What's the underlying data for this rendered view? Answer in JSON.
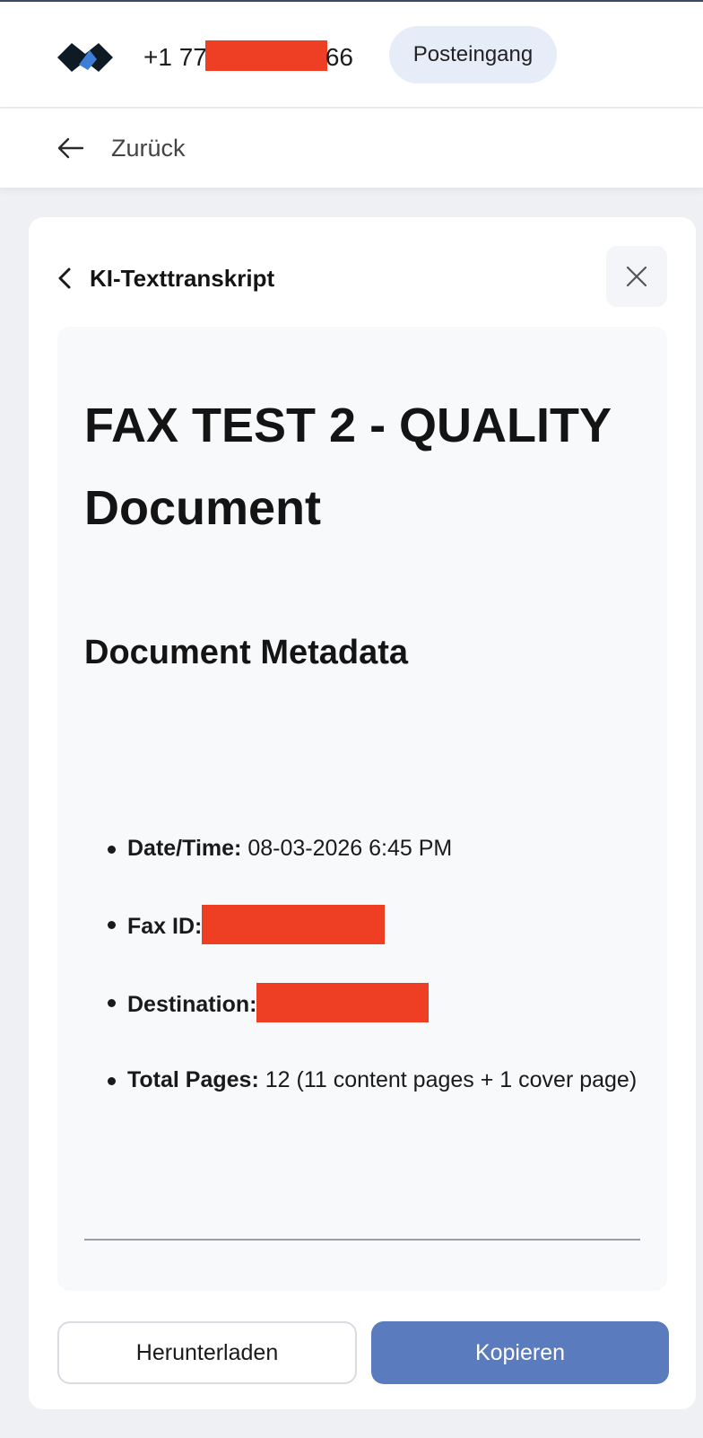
{
  "header": {
    "phone_prefix": "+1 77",
    "phone_suffix": "66",
    "inbox_label": "Posteingang"
  },
  "subbar": {
    "back_label": "Zurück"
  },
  "card": {
    "title": "KI-Texttranskript",
    "document": {
      "title": "FAX TEST 2 - QUALITY Document",
      "section_heading": "Document Metadata",
      "metadata": [
        {
          "key": "Date/Time:",
          "value": "08-03-2026 6:45 PM"
        },
        {
          "key": "Fax ID:",
          "value": ""
        },
        {
          "key": "Destination:",
          "value": ""
        },
        {
          "key": "Total Pages:",
          "value": "12 (11 content pages + 1 cover page)"
        }
      ]
    },
    "buttons": {
      "download": "Herunterladen",
      "copy": "Kopieren"
    }
  },
  "colors": {
    "accent": "#5b7bbf",
    "redaction": "#ee3e23",
    "pill_bg": "#e7edf8"
  },
  "icons": [
    "logo-icon",
    "arrow-left-icon",
    "chevron-left-icon",
    "close-icon"
  ]
}
